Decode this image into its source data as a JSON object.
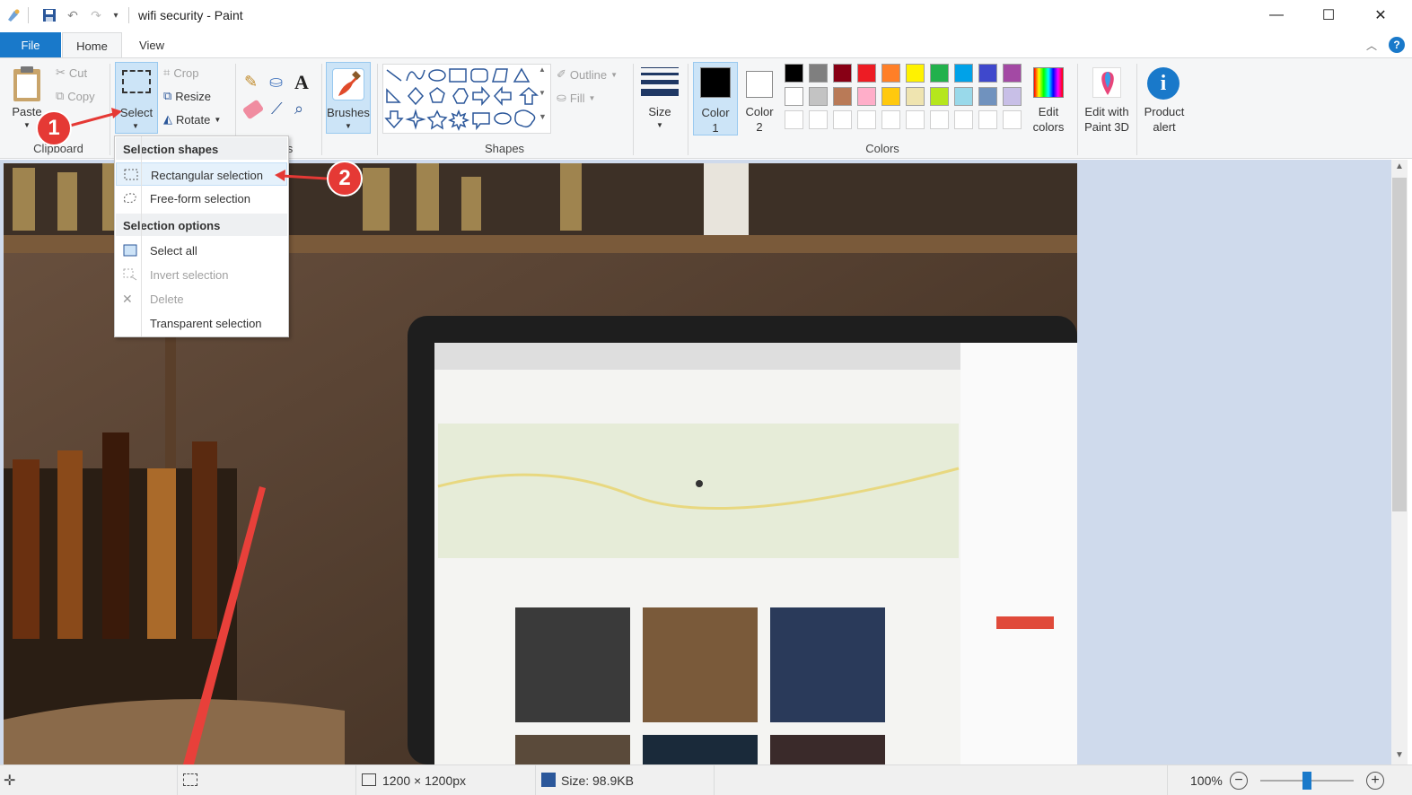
{
  "window": {
    "title": "wifi security - Paint",
    "minimize": "—",
    "maximize": "☐",
    "close": "✕"
  },
  "tabs": {
    "file": "File",
    "home": "Home",
    "view": "View"
  },
  "clipboard": {
    "paste": "Paste",
    "cut": "Cut",
    "copy": "Copy",
    "group": "Clipboard"
  },
  "image": {
    "select": "Select",
    "crop": "Crop",
    "resize": "Resize",
    "rotate": "Rotate"
  },
  "tools": {
    "group_tail": "s"
  },
  "brushes": {
    "label": "Brushes"
  },
  "shapes": {
    "outline": "Outline",
    "fill": "Fill",
    "group": "Shapes"
  },
  "size": {
    "label": "Size"
  },
  "colors": {
    "color1": "Color",
    "color1_num": "1",
    "color2": "Color",
    "color2_num": "2",
    "edit": "Edit",
    "edit2": "colors",
    "group": "Colors",
    "palette": [
      "#000000",
      "#7f7f7f",
      "#880015",
      "#ed1c24",
      "#ff7f27",
      "#fff200",
      "#22b14c",
      "#00a2e8",
      "#3f48cc",
      "#a349a4",
      "#ffffff",
      "#c3c3c3",
      "#b97a57",
      "#ffaec9",
      "#ffc90e",
      "#efe4b0",
      "#b5e61d",
      "#99d9ea",
      "#7092be",
      "#c8bfe7"
    ]
  },
  "paint3d": {
    "line1": "Edit with",
    "line2": "Paint 3D"
  },
  "alert": {
    "line1": "Product",
    "line2": "alert"
  },
  "dropdown": {
    "head1": "Selection shapes",
    "rect": "Rectangular selection",
    "free": "Free-form selection",
    "head2": "Selection options",
    "all": "Select all",
    "invert": "Invert selection",
    "delete": "Delete",
    "transparent": "Transparent selection"
  },
  "annotations": {
    "one": "1",
    "two": "2"
  },
  "status": {
    "dimensions": "1200 × 1200px",
    "size": "Size: 98.9KB",
    "zoom": "100%",
    "zoom_level": 0.5
  },
  "accent": "#1979ca"
}
